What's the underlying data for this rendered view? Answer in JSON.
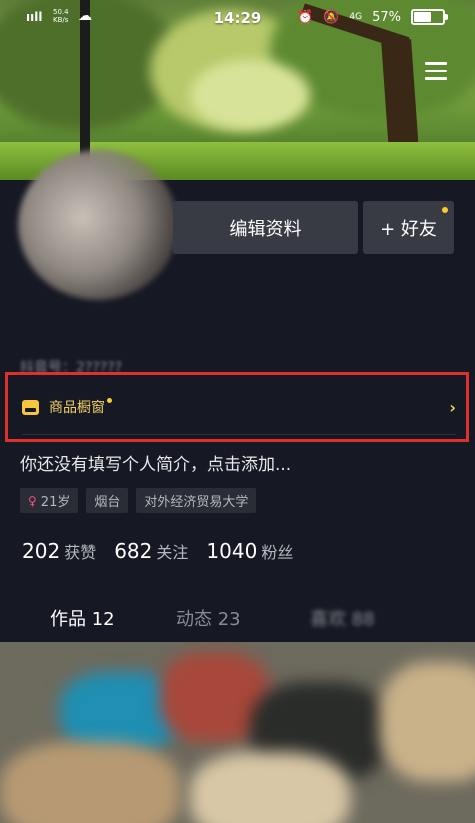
{
  "status_bar": {
    "time": "14:29",
    "signal": "ııll",
    "network_speed": "50.4 KB/s",
    "battery": "57%",
    "battery_level": 0.57,
    "lte": "4G"
  },
  "profile": {
    "edit_button": "编辑资料",
    "friend_button": "+ 好友",
    "account_id": "抖音号：2?????",
    "shop_window": "商品橱窗",
    "bio": "你还没有填写个人简介，点击添加...",
    "tags": [
      "21岁",
      "烟台",
      "对外经济贸易大学"
    ]
  },
  "stats": [
    {
      "value": "202",
      "label": "获赞"
    },
    {
      "value": "682",
      "label": "关注"
    },
    {
      "value": "1040",
      "label": "粉丝"
    }
  ],
  "tabs": {
    "works": "作品 12",
    "dynamic": "动态 23",
    "likes": "喜欢 88"
  },
  "colors": {
    "background": "#161823",
    "button": "#393b44",
    "highlight_border": "#e0302c",
    "shop_gold": "#f2cf63"
  }
}
